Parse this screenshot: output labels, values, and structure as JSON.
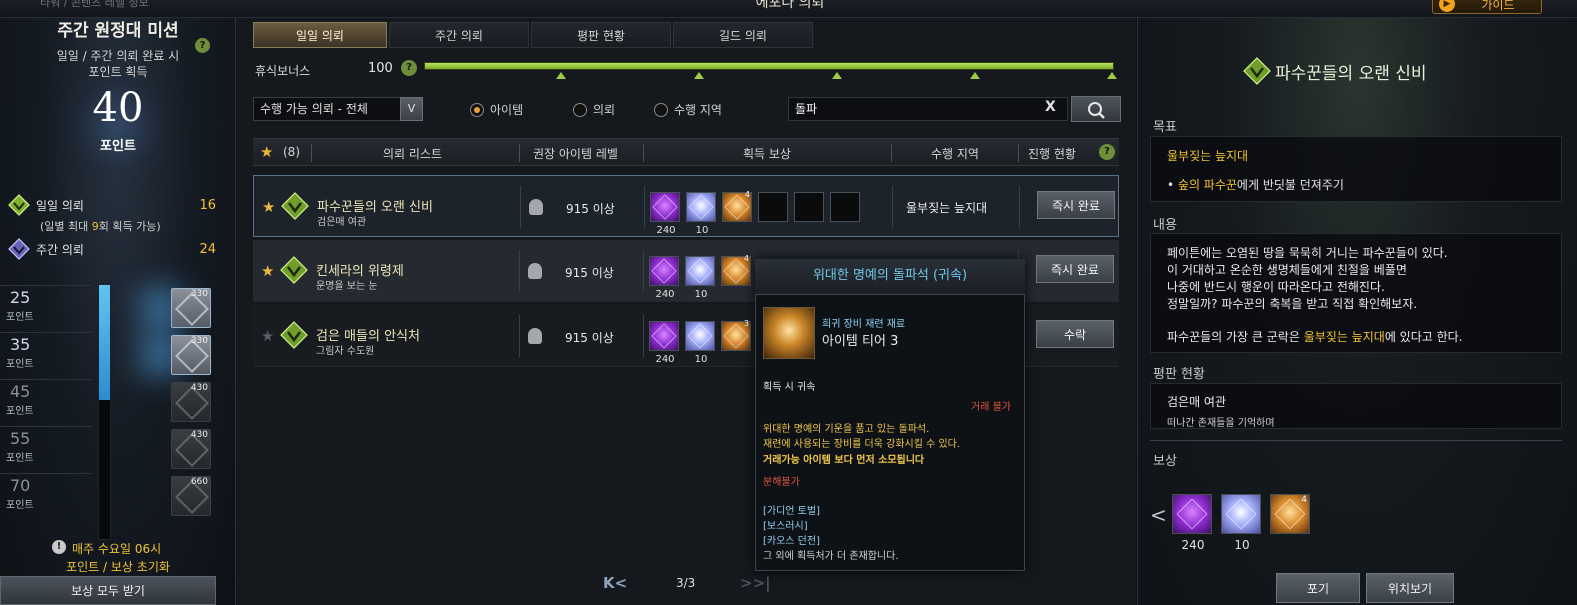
{
  "header": {
    "window_title": "에포나 의뢰",
    "top_left_text": "타워 / 콘텐츠 레벨 정보",
    "guide_label": "가이드"
  },
  "left_panel": {
    "title": "주간 원정대 미션",
    "help_icon": "?",
    "description_line1": "일일 / 주간 의뢰 완료 시",
    "description_line2": "포인트 획득",
    "points": "40",
    "points_label": "포인트",
    "daily_label": "일일 의뢰",
    "daily_count": "16",
    "daily_sub_prefix": "(일별 최대 ",
    "daily_sub_num": "9",
    "daily_sub_suffix": "회 획득 가능)",
    "weekly_label": "주간 의뢰",
    "weekly_count": "24",
    "tiers": [
      {
        "points": "25",
        "label": "포인트",
        "reward_count": "330"
      },
      {
        "points": "35",
        "label": "포인트",
        "reward_count": "330"
      },
      {
        "points": "45",
        "label": "포인트",
        "reward_count": "430"
      },
      {
        "points": "55",
        "label": "포인트",
        "reward_count": "430"
      },
      {
        "points": "70",
        "label": "포인트",
        "reward_count": "660"
      }
    ],
    "reset_line1": "매주 수요일 06시",
    "reset_line2": "포인트 / 보상 초기화",
    "claim_all_label": "보상 모두 받기"
  },
  "center": {
    "tabs": [
      {
        "label": "일일 의뢰",
        "active": true
      },
      {
        "label": "주간 의뢰",
        "active": false
      },
      {
        "label": "평판 현황",
        "active": false
      },
      {
        "label": "길드 의뢰",
        "active": false
      }
    ],
    "rest_bonus_label": "휴식보너스",
    "rest_bonus_value": "100",
    "rest_bonus_fill": 1.0,
    "filter_value": "수행 가능 의뢰 - 전체",
    "filter_arrow": "V",
    "radio_options": [
      {
        "label": "아이템",
        "selected": true
      },
      {
        "label": "의뢰",
        "selected": false
      },
      {
        "label": "수행 지역",
        "selected": false
      }
    ],
    "search_value": "돌파",
    "search_clear": "X",
    "list_header": {
      "favorite_count": "(8)",
      "col_list": "의뢰 리스트",
      "col_level": "권장 아이템 레벨",
      "col_reward": "획득 보상",
      "col_region": "수행 지역",
      "col_progress": "진행 현황",
      "help": "?"
    },
    "quests": [
      {
        "name": "파수꾼들의 오랜 신비",
        "sub": "검은매 여관",
        "level": "915 이상",
        "rewards": [
          {
            "value": "240"
          },
          {
            "value": "10"
          },
          {
            "value": "",
            "count": "4"
          }
        ],
        "region": "울부짖는 늪지대",
        "button": "즉시 완료"
      },
      {
        "name": "킨세라의 위령제",
        "sub": "운명을 보는 눈",
        "level": "915 이상",
        "rewards": [
          {
            "value": "240"
          },
          {
            "value": "10"
          },
          {
            "value": "",
            "count": "4"
          }
        ],
        "region": "",
        "button": "즉시 완료"
      },
      {
        "name": "검은 매들의 안식처",
        "sub": "그림자 수도원",
        "level": "915 이상",
        "rewards": [
          {
            "value": "240"
          },
          {
            "value": "10"
          },
          {
            "value": "",
            "count": "3"
          }
        ],
        "region": "",
        "button": "수락"
      }
    ],
    "pager": {
      "prev": "K<",
      "text": "3/3",
      "next": ">>|"
    }
  },
  "tooltip": {
    "title": "위대한 명예의 돌파석 (귀속)",
    "rarity": "희귀 장비 재련 재료",
    "tier": "아이템 티어 3",
    "bind": "획득 시 귀속",
    "trade": "거래 불가",
    "desc1": "위대한 명예의 기운을 품고 있는 돌파석.",
    "desc2": "재련에 사용되는 장비를 더욱 강화시킬 수 있다.",
    "desc3": "거래가능 아이템 보다 먼저 소모됩니다",
    "no_disassemble": "분해불가",
    "sources": [
      "[가디언 토벌]",
      "[보스러시]",
      "[카오스 던전]"
    ],
    "more": "그 외에 획득처가 더 존재합니다."
  },
  "right_panel": {
    "title": "파수꾼들의 오랜 신비",
    "goal_heading": "목표",
    "goal_location": "울부짖는 늪지대",
    "goal_task_prefix": "• ",
    "goal_task_highlight": "숲의 파수꾼",
    "goal_task_suffix": "에게 반딧불 던져주기",
    "content_heading": "내용",
    "content_lines": [
      "페이튼에는 오염된 땅을 묵묵히 거니는 파수꾼들이 있다.",
      "이 거대하고 온순한 생명체들에게 친절을 베풀면",
      "나중에 반드시 행운이 따라온다고 전해진다.",
      "정말일까? 파수꾼의 축복을 받고 직접 확인해보자."
    ],
    "content_last_prefix": "파수꾼들의 가장 큰 군락은 ",
    "content_last_highlight": "울부짖는 늪지대",
    "content_last_suffix": "에 있다고 한다.",
    "reputation_heading": "평판 현황",
    "reputation_name": "검은매 여관",
    "reputation_desc": "떠나간 존재들을 기억하며",
    "reward_heading": "보상",
    "rewards": [
      {
        "value": "240"
      },
      {
        "value": "10"
      },
      {
        "value": "",
        "count": "4"
      }
    ],
    "prev_arrow": "<",
    "btn_abandon": "포기",
    "btn_location": "위치보기"
  },
  "colors": {
    "accent_gold": "#f1c232",
    "accent_green": "#9ccc41",
    "tooltip_title": "#6fc7e8",
    "warning_red": "#e0553d"
  }
}
